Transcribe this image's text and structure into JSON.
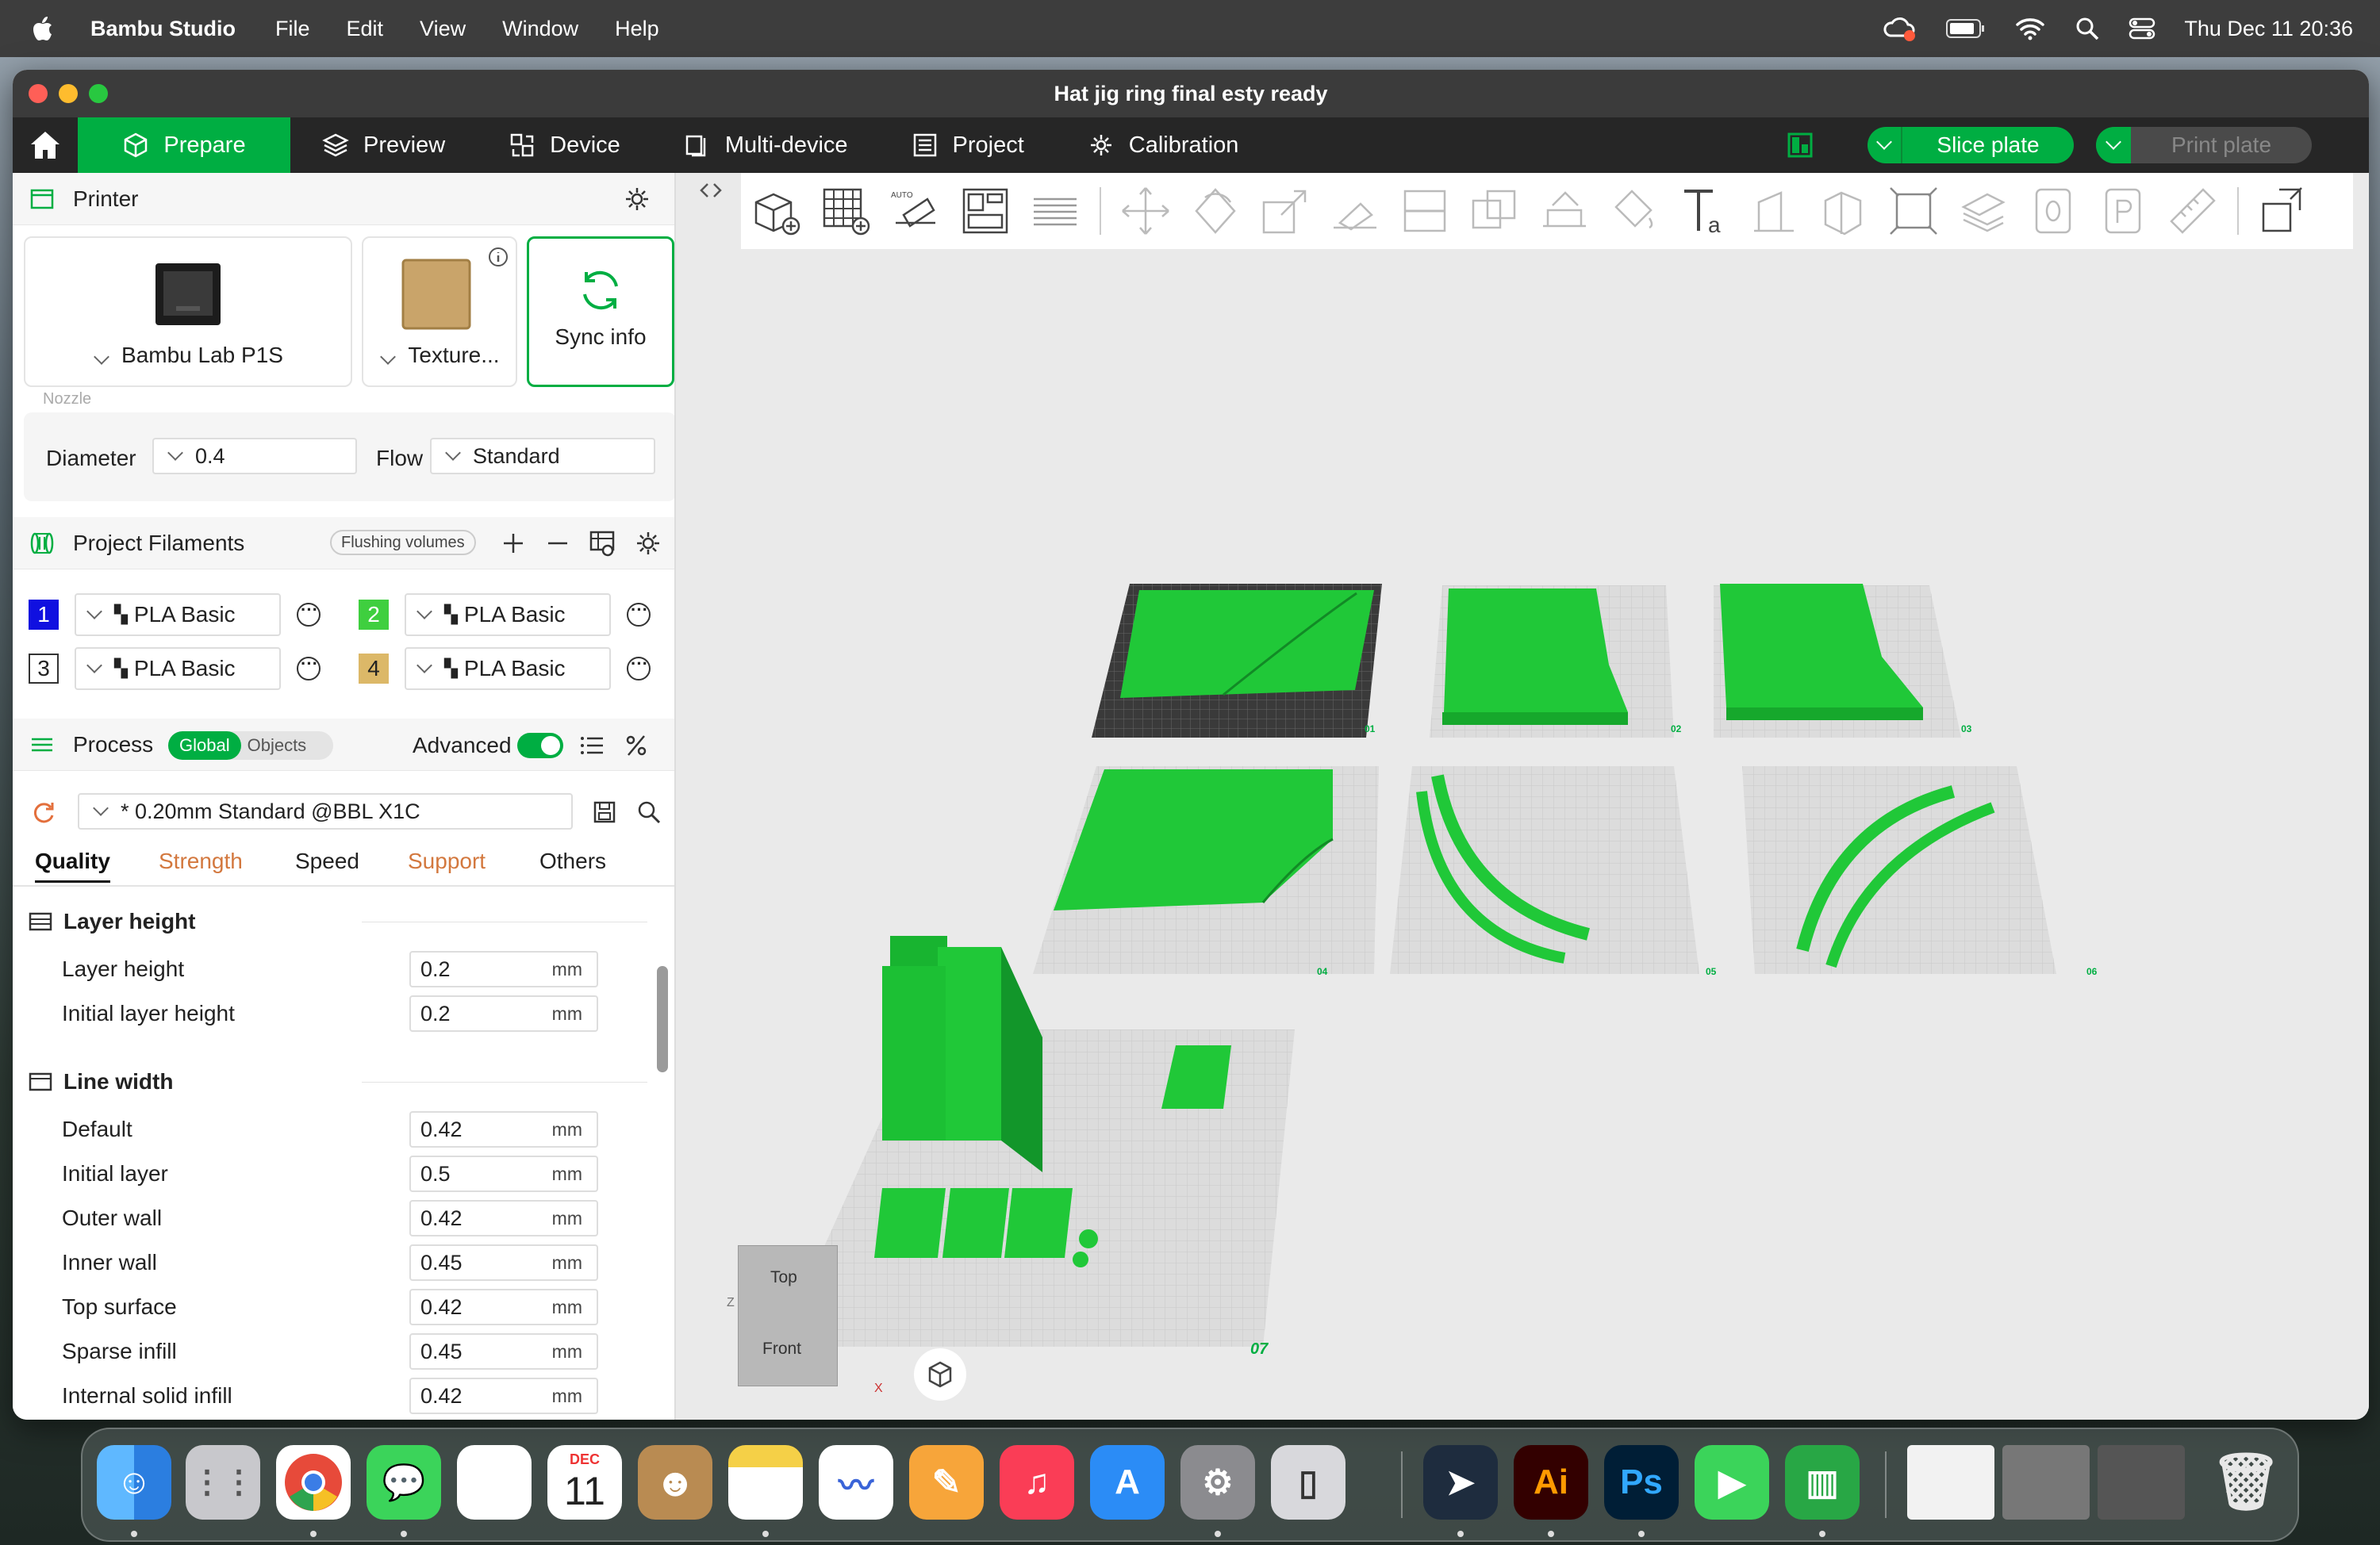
{
  "menubar": {
    "app_name": "Bambu Studio",
    "items": [
      "File",
      "Edit",
      "View",
      "Window",
      "Help"
    ],
    "clock": "Thu Dec 11  20:36"
  },
  "window": {
    "title": "Hat jig ring final esty ready"
  },
  "nav": {
    "tabs": [
      {
        "label": "Prepare",
        "icon": "cube-icon",
        "active": true
      },
      {
        "label": "Preview",
        "icon": "layers-icon"
      },
      {
        "label": "Device",
        "icon": "device-icon"
      },
      {
        "label": "Multi-device",
        "icon": "multi-device-icon"
      },
      {
        "label": "Project",
        "icon": "project-icon"
      },
      {
        "label": "Calibration",
        "icon": "calibration-icon"
      }
    ],
    "slice_label": "Slice plate",
    "print_label": "Print plate"
  },
  "printer": {
    "section_title": "Printer",
    "printer_name": "Bambu Lab P1S",
    "plate_name": "Texture...",
    "sync_label": "Sync info",
    "nozzle_caption": "Nozzle",
    "diameter_label": "Diameter",
    "diameter_value": "0.4",
    "flow_label": "Flow",
    "flow_value": "Standard"
  },
  "filaments": {
    "section_title": "Project Filaments",
    "flushing_label": "Flushing volumes",
    "items": [
      {
        "num": "1",
        "name": "PLA Basic",
        "color": "#1010e0",
        "text": "#ffffff"
      },
      {
        "num": "2",
        "name": "PLA Basic",
        "color": "#3fcf3f",
        "text": "#ffffff"
      },
      {
        "num": "3",
        "name": "PLA Basic",
        "color": "#ffffff",
        "text": "#222222"
      },
      {
        "num": "4",
        "name": "PLA Basic",
        "color": "#dcb868",
        "text": "#222222"
      }
    ]
  },
  "process": {
    "section_title": "Process",
    "toggle_global": "Global",
    "toggle_objects": "Objects",
    "advanced_label": "Advanced",
    "advanced_on": true,
    "preset": "* 0.20mm Standard @BBL X1C",
    "tabs": [
      "Quality",
      "Strength",
      "Speed",
      "Support",
      "Others"
    ],
    "groups": [
      {
        "title": "Layer height",
        "rows": [
          {
            "label": "Layer height",
            "value": "0.2",
            "unit": "mm"
          },
          {
            "label": "Initial layer height",
            "value": "0.2",
            "unit": "mm"
          }
        ]
      },
      {
        "title": "Line width",
        "rows": [
          {
            "label": "Default",
            "value": "0.42",
            "unit": "mm"
          },
          {
            "label": "Initial layer",
            "value": "0.5",
            "unit": "mm"
          },
          {
            "label": "Outer wall",
            "value": "0.42",
            "unit": "mm"
          },
          {
            "label": "Inner wall",
            "value": "0.45",
            "unit": "mm"
          },
          {
            "label": "Top surface",
            "value": "0.42",
            "unit": "mm"
          },
          {
            "label": "Sparse infill",
            "value": "0.45",
            "unit": "mm"
          },
          {
            "label": "Internal solid infill",
            "value": "0.42",
            "unit": "mm"
          }
        ]
      }
    ]
  },
  "viewport": {
    "plates": [
      "01",
      "02",
      "03",
      "04",
      "05",
      "06",
      "07"
    ],
    "cube_top": "Top",
    "cube_front": "Front",
    "axis_z": "Z",
    "axis_x": "X",
    "model_color": "#1ecf3a"
  },
  "dock": {
    "calendar_month": "DEC",
    "calendar_day": "11",
    "ai_label": "Ai",
    "ps_label": "Ps"
  }
}
